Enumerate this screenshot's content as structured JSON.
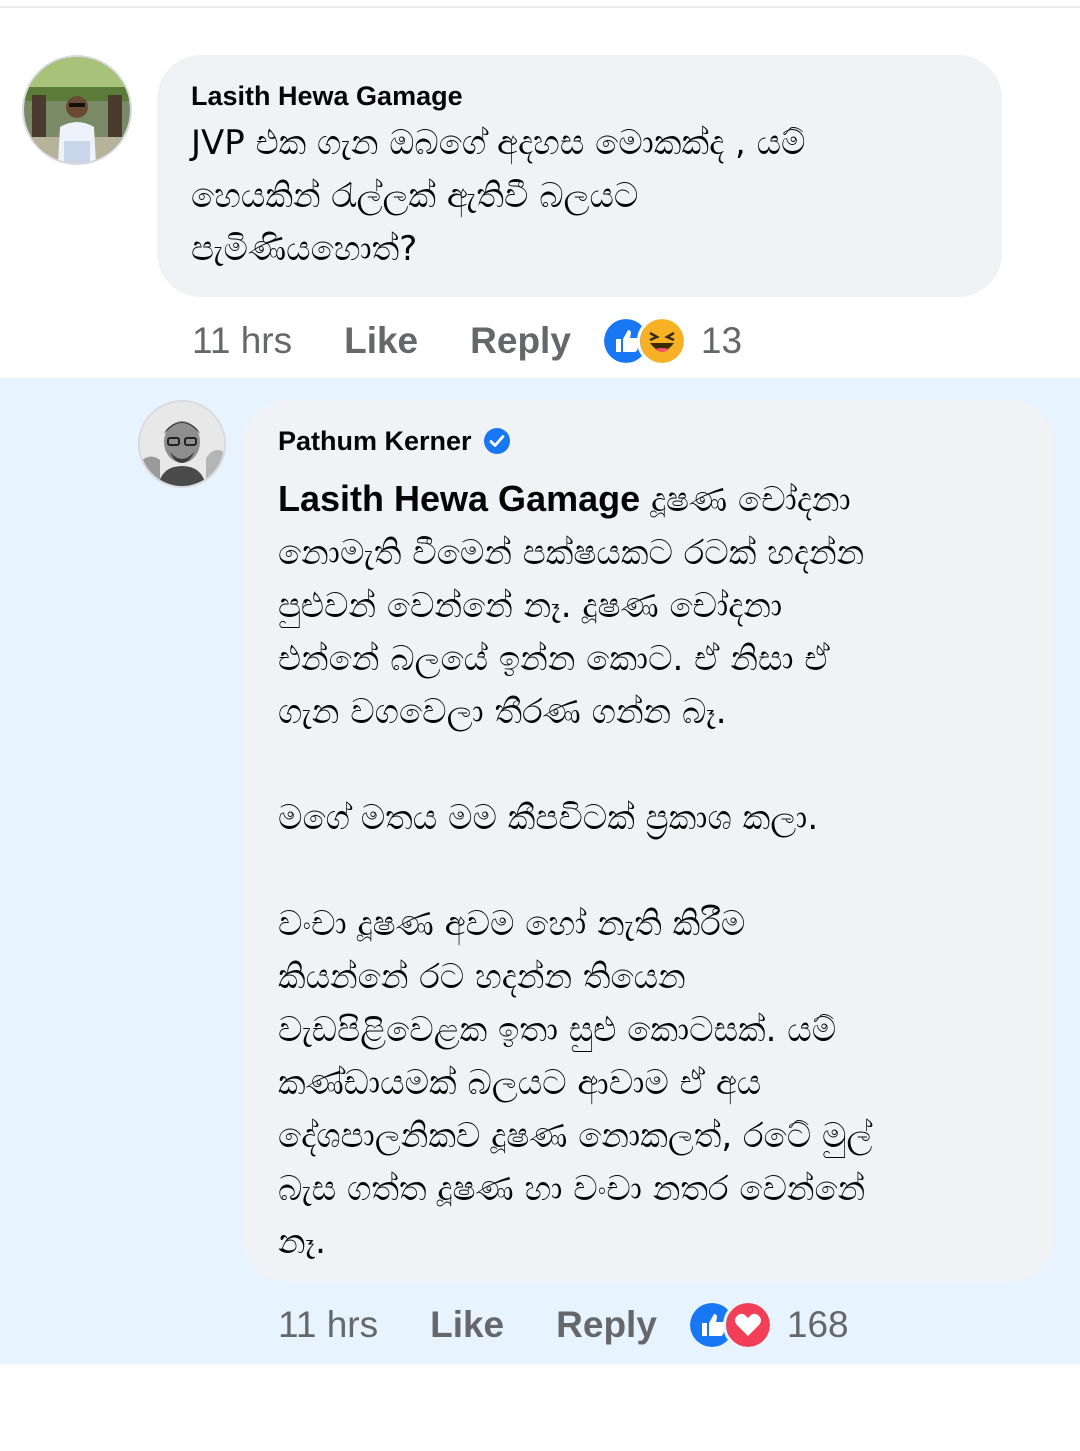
{
  "comment1": {
    "author": "Lasith Hewa Gamage",
    "text": "JVP එක ගැන ඔබගේ අදහස මොකක්ද , යම්\nහෙයකින් රැල්ලක් ඇතිවී බලයට\nපැමිණියහොත්?",
    "time": "11 hrs",
    "like_label": "Like",
    "reply_label": "Reply",
    "reaction_icons": [
      "like-icon",
      "haha-icon"
    ],
    "reaction_count": "13"
  },
  "comment2": {
    "author": "Pathum Kerner",
    "verified": true,
    "mention": "Lasith Hewa Gamage",
    "text_after_mention": " දූෂණ චෝදනා\nනොමැති වීමෙන් පක්ෂයකට රටක් හදන්න\nපුළුවන් වෙන්නේ නෑ. දූෂණ චෝදනා\nඑන්නේ බලයේ ඉන්න කොට. ඒ නිසා ඒ\nගැන වගවෙලා තීරණ ගන්න බෑ.\n\nමගේ මතය මම කීපවිටක් ප්‍රකාශ කලා.\n\nවංචා දූෂණ අවම හෝ නැති කිරීම\nකියන්නේ රට හදන්න තියෙන\nවැඩපිළිවෙළක ඉතා සුළු කොටසක්. යම්\nකණ්ඩායමක් බලයට ආවාම ඒ අය\nදේශපාලනිකව දූෂණ නොකලත්, රටේ මුල්\nබැස ගත්ත දූෂණ හා වංචා නතර වෙන්නේ\nනෑ.",
    "time": "11 hrs",
    "like_label": "Like",
    "reply_label": "Reply",
    "reaction_icons": [
      "like-icon",
      "love-icon"
    ],
    "reaction_count": "168"
  },
  "colors": {
    "bubble": "#f0f2f5",
    "highlight": "#e7f3ff",
    "meta_text": "#65676b",
    "like_blue": "#1877f2",
    "love_red": "#f33e58",
    "haha_yellow": "#f7b125",
    "verified_blue": "#1877f2"
  }
}
